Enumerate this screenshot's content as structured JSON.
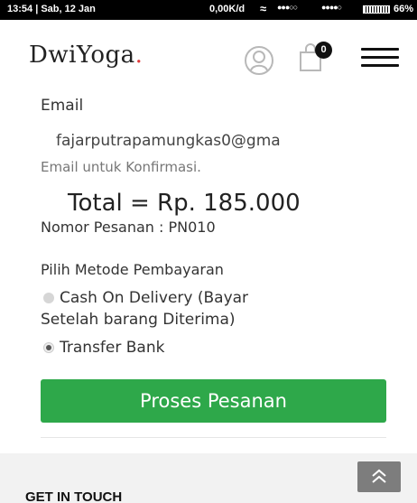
{
  "status_bar": {
    "time_date": "13:54 | Sab, 12 Jan",
    "network_speed": "0,00K/d",
    "battery_percent": "66%",
    "icons": [
      "wifi-icon",
      "signal-icon",
      "battery-icon"
    ]
  },
  "header": {
    "logo_text": "DwiYoga",
    "logo_dot": ".",
    "cart_count": "0",
    "icons": [
      "user-icon",
      "cart-icon",
      "menu-icon"
    ]
  },
  "form": {
    "email_label": "Email",
    "email_value": "fajarputrapamungkas0@gma",
    "email_hint": "Email untuk Konfirmasi.",
    "total": "Total = Rp. 185.000",
    "order_number": "Nomor Pesanan : PN010",
    "payment_title": "Pilih Metode Pembayaran",
    "payment_options": [
      {
        "label_line1": "Cash On Delivery (Bayar",
        "label_line2": "Setelah barang Diterima)",
        "selected": false
      },
      {
        "label_line1": "Transfer Bank",
        "selected": true
      }
    ],
    "submit_label": "Proses Pesanan"
  },
  "footer": {
    "title": "GET IN TOUCH",
    "scroll_top_icon": "chevron-up-double-icon"
  },
  "colors": {
    "accent_green": "#2ea84a",
    "logo_dot_red": "#e03a3a"
  }
}
